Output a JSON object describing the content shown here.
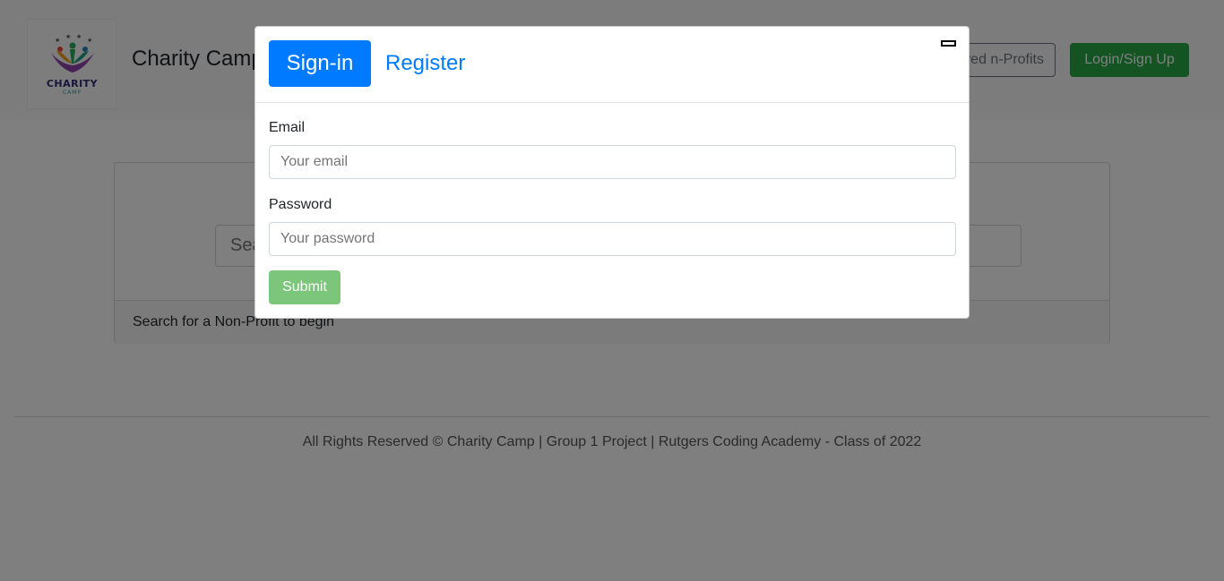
{
  "header": {
    "logo_text": "CHARITY",
    "logo_subtext": "CAMP",
    "brand_title": "Charity Camp",
    "saved_button_label": "Saved n-Profits",
    "login_button_label": "Login/Sign Up"
  },
  "search": {
    "placeholder": "Search",
    "card_footer_text": "Search for a Non-Profit to begin"
  },
  "footer": {
    "text": "All Rights Reserved © Charity Camp | Group 1 Project | Rutgers Coding Academy - Class of 2022"
  },
  "modal": {
    "tab_signin_label": "Sign-in",
    "tab_register_label": "Register",
    "email_label": "Email",
    "email_placeholder": "Your email",
    "password_label": "Password",
    "password_placeholder": "Your password",
    "submit_label": "Submit"
  },
  "colors": {
    "primary": "#007bff",
    "success": "#28a745",
    "submit_disabled": "#5cb85c"
  }
}
